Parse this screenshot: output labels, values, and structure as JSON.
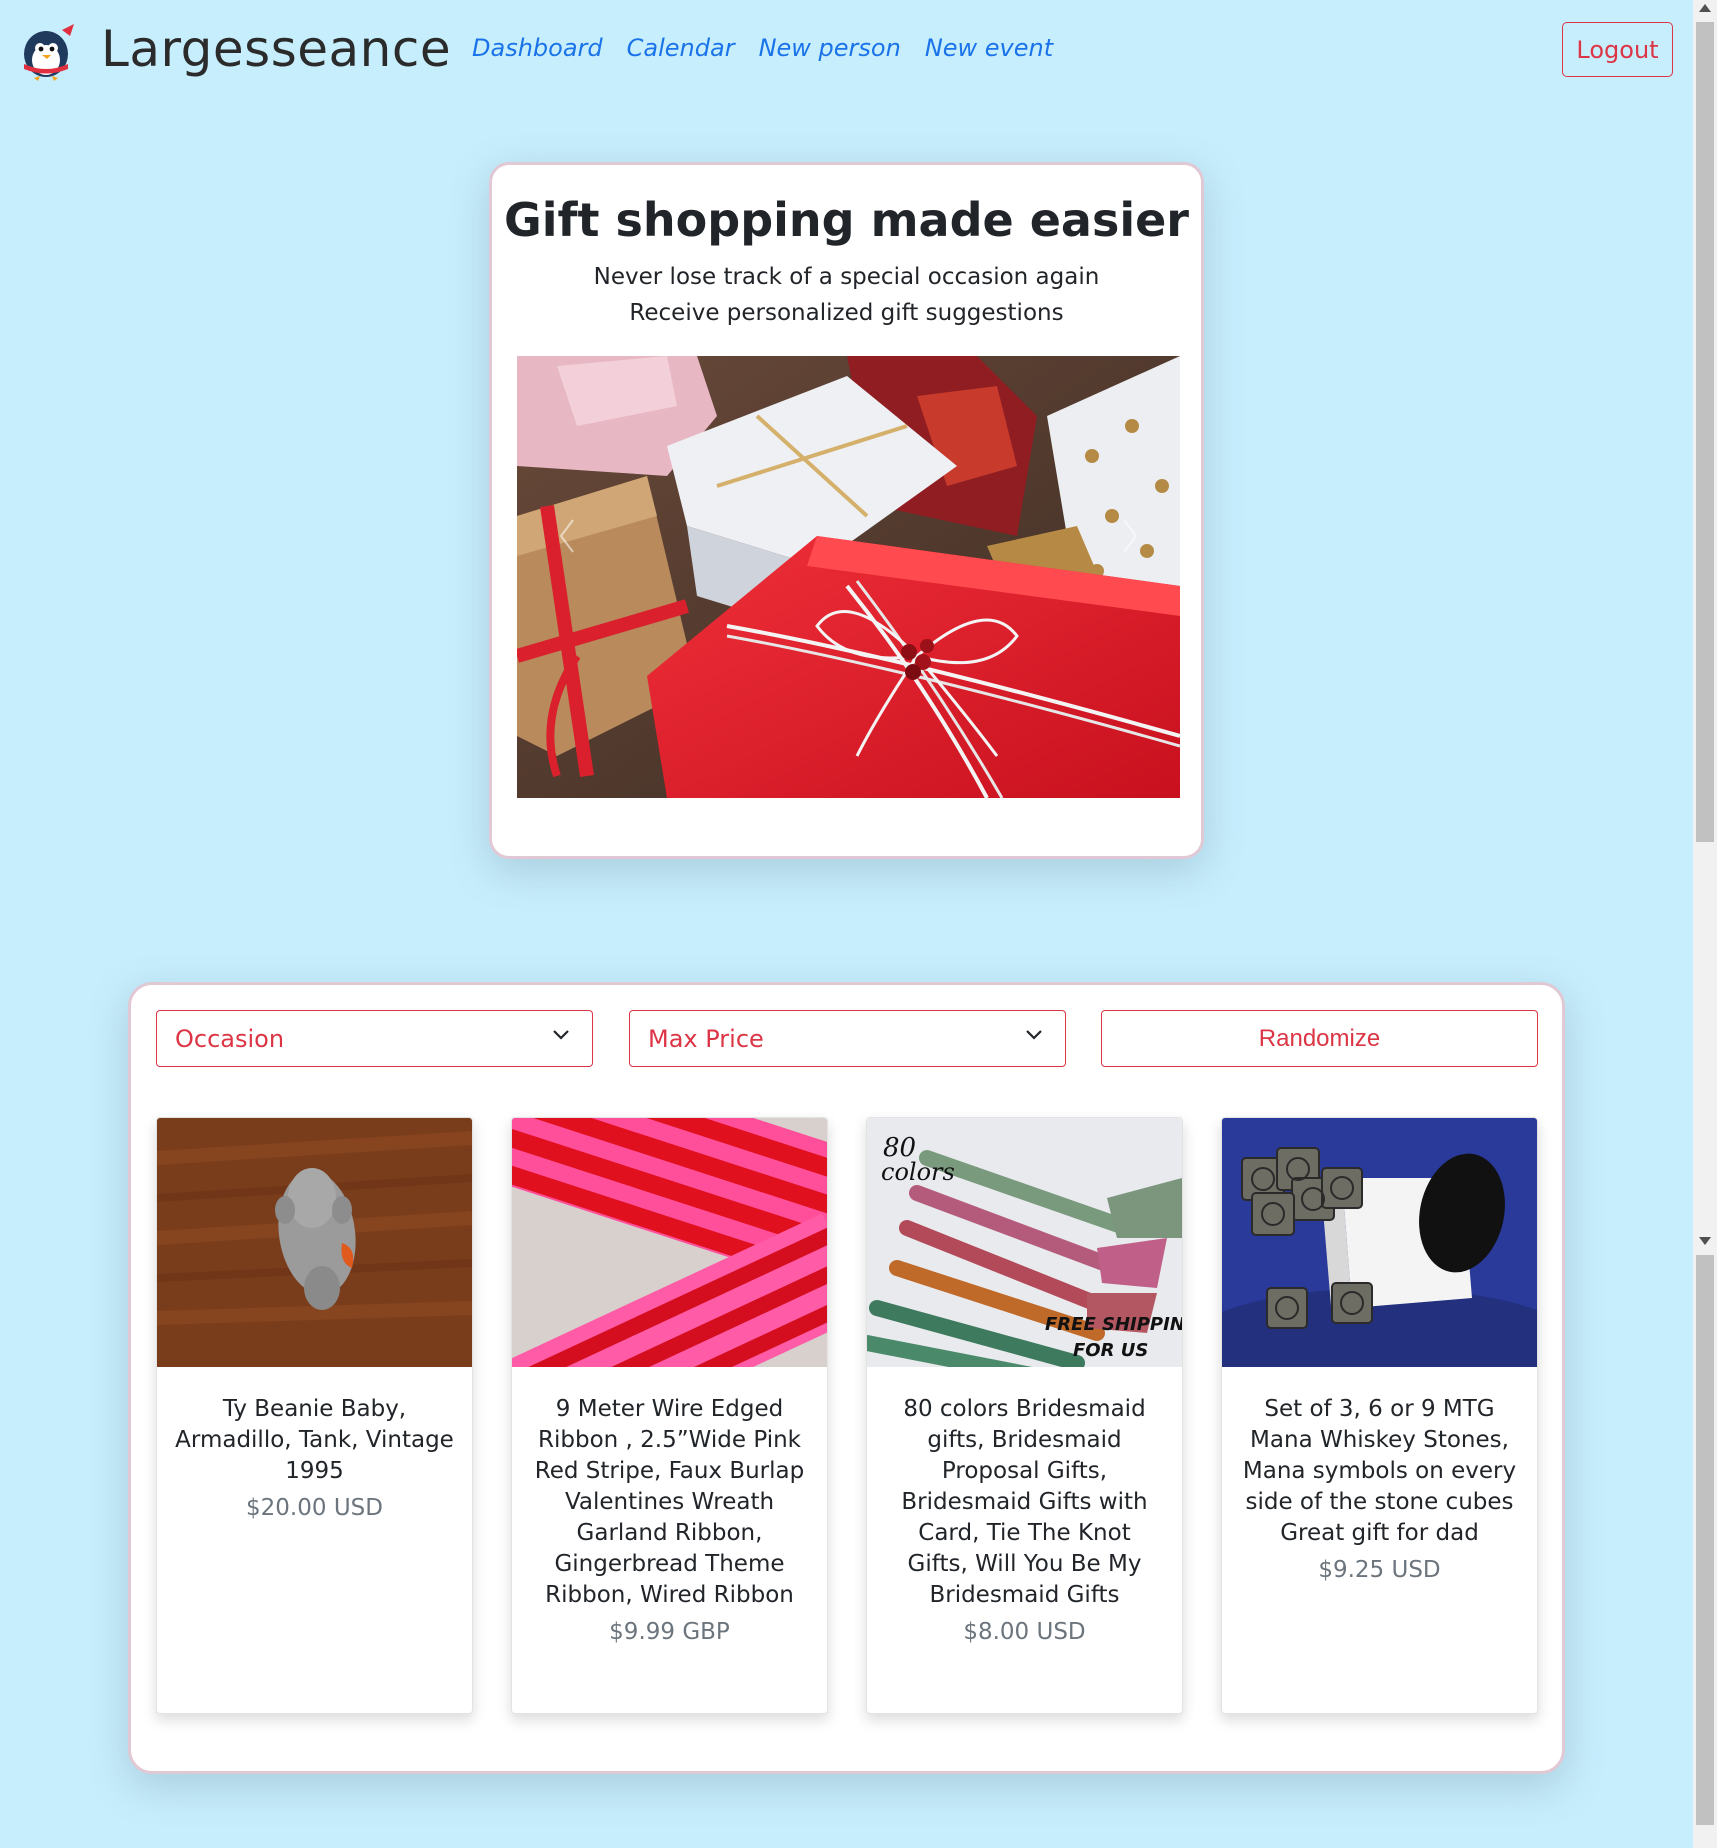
{
  "navbar": {
    "brand": "Largesseance",
    "links": [
      "Dashboard",
      "Calendar",
      "New person",
      "New event"
    ],
    "logout": "Logout"
  },
  "hero": {
    "title": "Gift shopping made easier",
    "subtitle1": "Never lose track of a special occasion again",
    "subtitle2": "Receive personalized gift suggestions"
  },
  "filters": {
    "occasion": "Occasion",
    "max_price": "Max Price",
    "randomize": "Randomize"
  },
  "products": [
    {
      "name": "Ty Beanie Baby, Armadillo, Tank, Vintage 1995",
      "price": "$20.00 USD"
    },
    {
      "name": "9 Meter Wire Edged Ribbon , 2.5”Wide Pink Red Stripe, Faux Burlap Valentines Wreath Garland Ribbon, Gingerbread Theme Ribbon, Wired Ribbon",
      "price": "$9.99 GBP"
    },
    {
      "name": "80 colors Bridesmaid gifts, Bridesmaid Proposal Gifts, Bridesmaid Gifts with Card, Tie The Knot Gifts, Will You Be My Bridesmaid Gifts",
      "price": "$8.00 USD"
    },
    {
      "name": "Set of 3, 6 or 9 MTG Mana Whiskey Stones, Mana symbols on every side of the stone cubes Great gift for dad",
      "price": "$9.25 USD"
    }
  ],
  "product_image_text": {
    "p3_line1": "80",
    "p3_line2": "colors",
    "p3_banner1": "FREE SHIPPING",
    "p3_banner2": "FOR US"
  },
  "colors": {
    "background": "#c7eefd",
    "accent": "#dc3545",
    "link": "#1a73e8",
    "card_border": "#e0c9d5"
  }
}
